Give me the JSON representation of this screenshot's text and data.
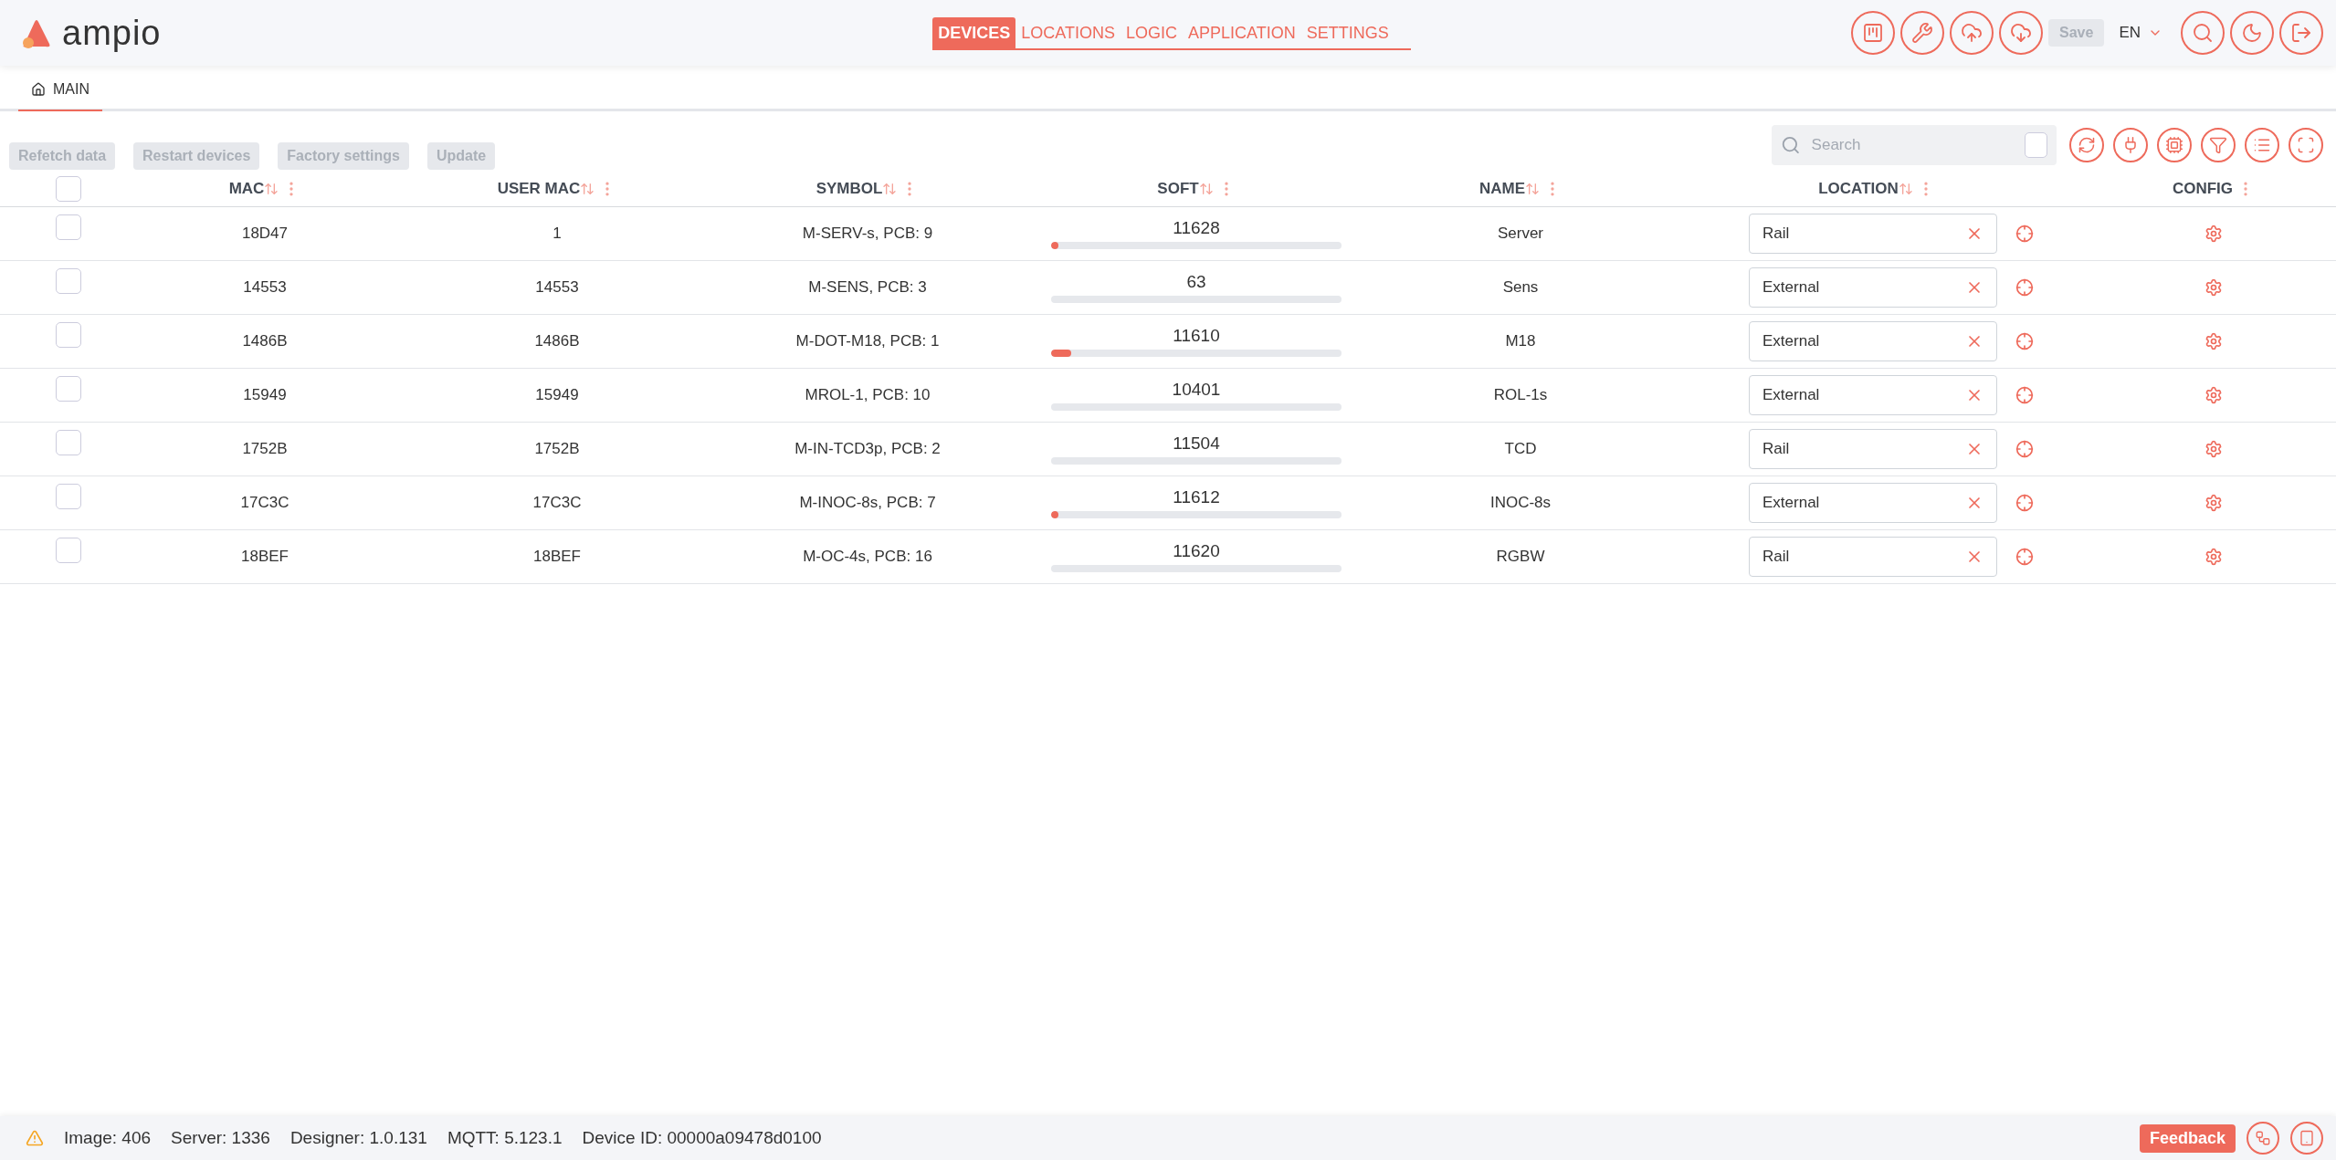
{
  "header": {
    "logo": "ampio",
    "nav": [
      {
        "label": "DEVICES",
        "selected": true
      },
      {
        "label": "LOCATIONS",
        "selected": false
      },
      {
        "label": "LOGIC",
        "selected": false
      },
      {
        "label": "APPLICATION",
        "selected": false
      },
      {
        "label": "SETTINGS",
        "selected": false
      }
    ],
    "save": {
      "label": "Save",
      "disabled": true
    },
    "language": "EN"
  },
  "page_tabs": [
    {
      "label": "MAIN",
      "selected": true
    }
  ],
  "actions": [
    {
      "label": "Refetch data",
      "disabled": true
    },
    {
      "label": "Restart devices",
      "disabled": true
    },
    {
      "label": "Factory settings",
      "disabled": true
    },
    {
      "label": "Update",
      "disabled": true
    }
  ],
  "search": {
    "placeholder": "Search",
    "checked": false
  },
  "table": {
    "select_all": false,
    "columns": [
      {
        "label": "MAC",
        "sortable": true
      },
      {
        "label": "USER MAC",
        "sortable": true
      },
      {
        "label": "SYMBOL",
        "sortable": true
      },
      {
        "label": "SOFT",
        "sortable": true
      },
      {
        "label": "NAME",
        "sortable": true
      },
      {
        "label": "LOCATION",
        "sortable": true
      },
      {
        "label": "CONFIG",
        "sortable": false
      }
    ],
    "rows": [
      {
        "checked": false,
        "mac": "18D47",
        "user_mac": "1",
        "symbol": "M-SERV-s, PCB: 9",
        "soft": "11628",
        "level": 0.02,
        "name": "Server",
        "location": "Rail"
      },
      {
        "checked": false,
        "mac": "14553",
        "user_mac": "14553",
        "symbol": "M-SENS, PCB: 3",
        "soft": "63",
        "level": 0,
        "name": "Sens",
        "location": "External"
      },
      {
        "checked": false,
        "mac": "1486B",
        "user_mac": "1486B",
        "symbol": "M-DOT-M18, PCB: 1",
        "soft": "11610",
        "level": 0.07,
        "name": "M18",
        "location": "External"
      },
      {
        "checked": false,
        "mac": "15949",
        "user_mac": "15949",
        "symbol": "MROL-1, PCB: 10",
        "soft": "10401",
        "level": 0,
        "name": "ROL-1s",
        "location": "External"
      },
      {
        "checked": false,
        "mac": "1752B",
        "user_mac": "1752B",
        "symbol": "M-IN-TCD3p, PCB: 2",
        "soft": "11504",
        "level": 0,
        "name": "TCD",
        "location": "Rail"
      },
      {
        "checked": false,
        "mac": "17C3C",
        "user_mac": "17C3C",
        "symbol": "M-INOC-8s, PCB: 7",
        "soft": "11612",
        "level": 0.02,
        "name": "INOC-8s",
        "location": "External"
      },
      {
        "checked": false,
        "mac": "18BEF",
        "user_mac": "18BEF",
        "symbol": "M-OC-4s, PCB: 16",
        "soft": "11620",
        "level": 0,
        "name": "RGBW",
        "location": "Rail"
      }
    ]
  },
  "status_bar": {
    "items": [
      "Image: 406",
      "Server: 1336",
      "Designer: 1.0.131",
      "MQTT: 5.123.1",
      "Device ID: 00000a09478d0100"
    ],
    "feedback": "Feedback"
  }
}
